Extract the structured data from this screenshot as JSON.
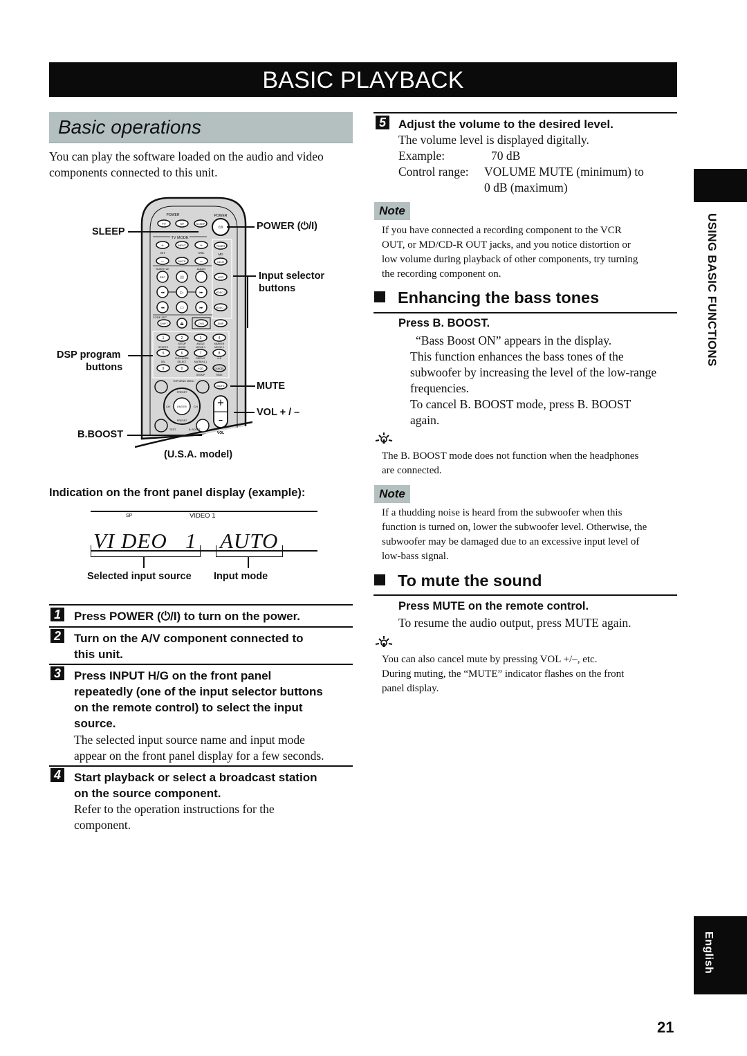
{
  "page": {
    "title": "BASIC PLAYBACK",
    "page_number": "21",
    "side_tab_section": "USING BASIC FUNCTIONS",
    "side_tab_language": "English"
  },
  "basic_operations": {
    "heading": "Basic operations",
    "intro_lines": [
      "You can play the software loaded on the audio and video",
      "components connected to this unit."
    ]
  },
  "remote_figure": {
    "callouts": {
      "sleep": "SLEEP",
      "power": "POWER (⏻/I)",
      "input_selector_line1": "Input selector",
      "input_selector_line2": "buttons",
      "dsp_line1": "DSP program",
      "dsp_line2": "buttons",
      "mute": "MUTE",
      "vol": "VOL + / –",
      "bboost": "B.BOOST"
    },
    "caption": "(U.S.A. model)",
    "remote_labels": {
      "power_group": "POWER",
      "power_single": "POWER",
      "tv": "TV",
      "av": "AV",
      "sleep": "SLEEP",
      "power_btn": "⏻/I",
      "tv_mode": "TV MODE",
      "input": "INPUT",
      "ch": "CH",
      "vol": "VOL",
      "mute": "MUTE",
      "subtitle": "SUBTITLE",
      "audio": "AUDIO",
      "rec": "REC",
      "timer": "TIMER",
      "md": "MD",
      "cdr": "CD-R",
      "vcr": "VCR",
      "video2": "VIDEO 2",
      "video1": "VIDEO 1",
      "code_set": "CODE SET",
      "shift": "SHIFT",
      "dvd": "DVD",
      "amp": "AMP",
      "digits": [
        "1",
        "2",
        "3",
        "4",
        "5",
        "6",
        "7",
        "8",
        "9",
        "0",
        "+10"
      ],
      "sports": "SPORTS",
      "setup": "SETUP",
      "angle": "ANGLE",
      "marker": "MARKER",
      "play_mode": "PLAY MODE",
      "repeat": "REPEAT",
      "select": "SELECT",
      "group": "GROUP",
      "cancel": "CANCEL",
      "page": "PAGE",
      "top_menu": "TOP MENU",
      "level": "LEVEL",
      "menu": "MENU",
      "set_menu": "SET MENU",
      "enter": "ENTER",
      "preset": "PRESET",
      "test": "TEST",
      "on_screen": "ON SCREEN",
      "b_boost": "B. BOOST",
      "return": "RETURN",
      "vol_label": "VOL"
    }
  },
  "display_example": {
    "heading": "Indication on the front panel display (example):",
    "indicator_sp": "SP",
    "indicator_input": "VIDEO 1",
    "source_text": "VI DEO   1",
    "mode_text": "AUTO",
    "source_label": "Selected input source",
    "mode_label": "Input mode"
  },
  "steps": [
    {
      "number": "1",
      "heading_lines": [
        "Press POWER (⏻/I) to turn on the power."
      ],
      "body_lines": []
    },
    {
      "number": "2",
      "heading_lines": [
        "Turn on the A/V component connected to",
        "this unit."
      ],
      "body_lines": []
    },
    {
      "number": "3",
      "heading_lines": [
        "Press INPUT H/G on the front panel",
        "repeatedly (one of the input selector buttons",
        "on the remote control) to select the input",
        "source."
      ],
      "body_lines": [
        "The selected input source name and input mode",
        "appear on the front panel display for a few seconds."
      ]
    },
    {
      "number": "4",
      "heading_lines": [
        "Start playback or select a broadcast station",
        "on the source component."
      ],
      "body_lines": [
        "Refer to the operation instructions for the",
        "component."
      ]
    },
    {
      "number": "5",
      "heading_lines": [
        "Adjust the volume to the desired level."
      ],
      "body_lines": [
        "The volume level is displayed digitally."
      ],
      "example_label": "Example:",
      "example_value": "70 dB",
      "range_label": "Control range:",
      "range_value_line1": "VOLUME MUTE (minimum) to",
      "range_value_line2": "0 dB (maximum)"
    }
  ],
  "note_volume": {
    "badge": "Note",
    "lines": [
      "If you have connected a recording component to the VCR",
      "OUT, or MD/CD-R OUT jacks, and you notice distortion or",
      "low volume during playback of other components, try turning",
      "the recording component on."
    ]
  },
  "bass_section": {
    "heading": "Enhancing the bass tones",
    "instruction": "Press B. BOOST.",
    "body_lines": [
      "“Bass Boost ON” appears in the display.",
      "This function enhances the bass tones of the",
      "subwoofer by increasing the level of the low-range",
      "frequencies.",
      "To cancel B. BOOST mode, press B. BOOST",
      "again."
    ],
    "tip_lines": [
      "The B. BOOST mode does not function when the headphones",
      "are connected."
    ],
    "note_badge": "Note",
    "note_lines": [
      "If a thudding noise is heard from the subwoofer when this",
      "function is turned on, lower the subwoofer level. Otherwise, the",
      "subwoofer may be damaged due to an excessive input level of",
      "low-bass signal."
    ]
  },
  "mute_section": {
    "heading": "To mute the sound",
    "instruction": "Press MUTE on the remote control.",
    "body_lines": [
      "To resume the audio output, press MUTE again."
    ],
    "tip_lines": [
      "You can also cancel mute by pressing VOL +/–, etc.",
      "During muting, the “MUTE” indicator flashes on the front",
      "panel display."
    ]
  }
}
